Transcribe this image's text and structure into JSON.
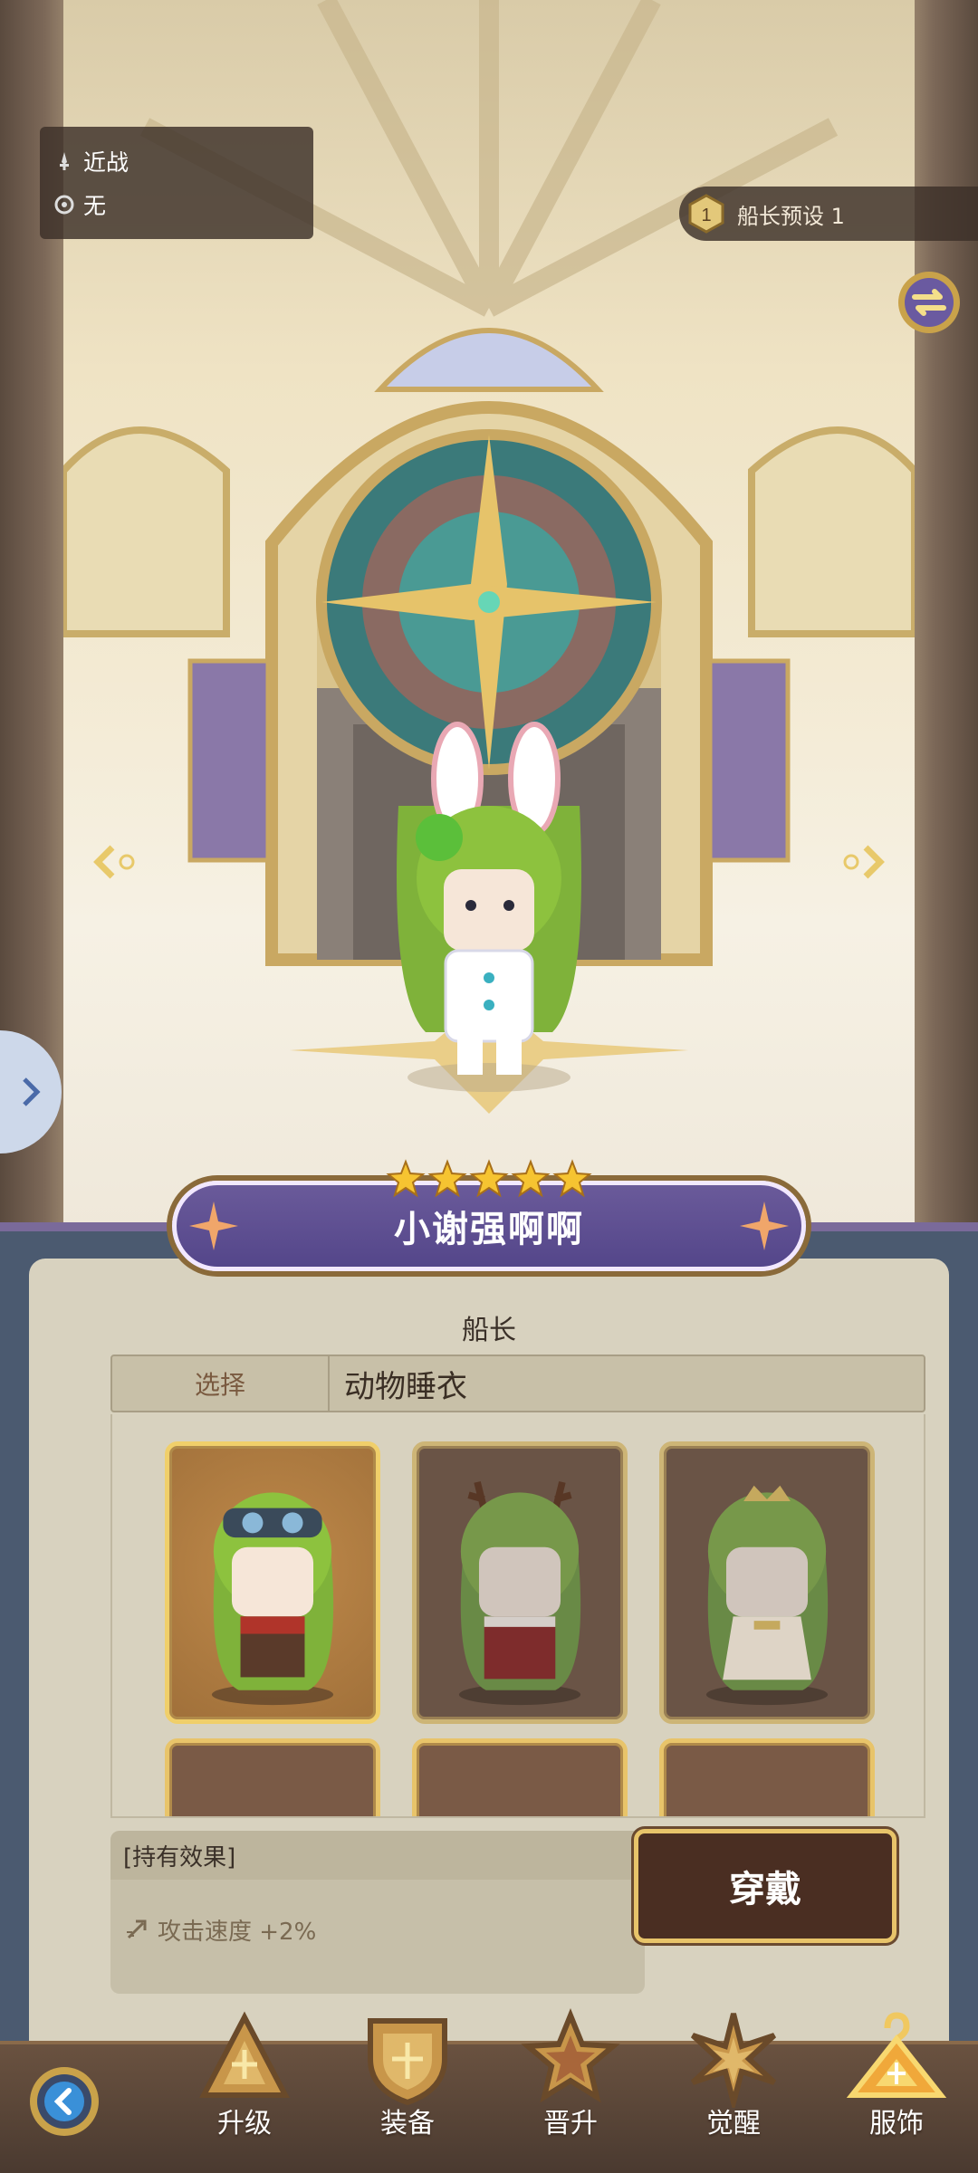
{
  "character": {
    "attack_type": "近战",
    "element": "无",
    "name": "小谢强啊啊",
    "stars": 5
  },
  "preset": {
    "number": "1",
    "label": "船长预设 1"
  },
  "panel": {
    "role_title": "船长",
    "select_label": "选择",
    "select_value": "动物睡衣",
    "skins": [
      {
        "state": "selected"
      },
      {
        "state": "locked"
      },
      {
        "state": "locked"
      },
      {
        "state": "empty"
      },
      {
        "state": "empty"
      },
      {
        "state": "empty"
      }
    ],
    "effects_header": "[持有效果]",
    "effect_text": "攻击速度 +2%",
    "wear_button": "穿戴"
  },
  "nav": {
    "items": [
      {
        "label": "升级",
        "icon": "triangle-upgrade-icon"
      },
      {
        "label": "装备",
        "icon": "shield-equip-icon"
      },
      {
        "label": "晋升",
        "icon": "star-promote-icon"
      },
      {
        "label": "觉醒",
        "icon": "spark-awaken-icon"
      },
      {
        "label": "服饰",
        "icon": "hanger-costume-icon"
      }
    ]
  },
  "colors": {
    "panel_bg": "#d8d2bf",
    "plate_purple": "#54468a",
    "gold": "#e8c46a",
    "button_dark": "#4a2e22"
  }
}
